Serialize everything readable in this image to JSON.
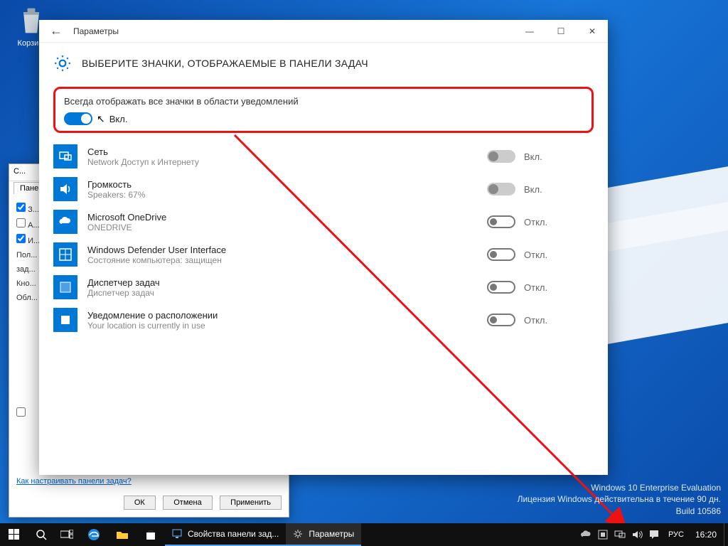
{
  "desktop": {
    "recycle_bin": "Корзи..."
  },
  "propsheet": {
    "title": "С...",
    "tab": "Пане...",
    "chk1": "З...",
    "chk2": "А...",
    "chk3": "И...",
    "lbl_pol": "Пол...",
    "lbl_zad": "зад...",
    "lbl_kno": "Кно...",
    "lbl_obl": "Обл...",
    "link": "Как настраивать панели задач?",
    "btn_ok": "ОК",
    "btn_cancel": "Отмена",
    "btn_apply": "Применить"
  },
  "settings": {
    "window_title": "Параметры",
    "heading": "ВЫБЕРИТЕ ЗНАЧКИ, ОТОБРАЖАЕМЫЕ В ПАНЕЛИ ЗАДАЧ",
    "master_label": "Всегда отображать все значки в области уведомлений",
    "master_state": "Вкл.",
    "items": [
      {
        "title": "Сеть",
        "sub": "Network Доступ к Интернету",
        "state": "Вкл.",
        "style": "off-disabled"
      },
      {
        "title": "Громкость",
        "sub": "Speakers: 67%",
        "state": "Вкл.",
        "style": "off-disabled"
      },
      {
        "title": "Microsoft OneDrive",
        "sub": "ONEDRIVE",
        "state": "Откл.",
        "style": "off-outlined"
      },
      {
        "title": "Windows Defender User Interface",
        "sub": "Состояние компьютера: защищен",
        "state": "Откл.",
        "style": "off-outlined"
      },
      {
        "title": "Диспетчер задач",
        "sub": "Диспетчер задач",
        "state": "Откл.",
        "style": "off-outlined"
      },
      {
        "title": "Уведомление о расположении",
        "sub": "Your location is currently in use",
        "state": "Откл.",
        "style": "off-outlined"
      }
    ]
  },
  "watermark": {
    "line1": "Windows 10 Enterprise Evaluation",
    "line2": "Лицензия Windows действительна в течение 90 дн.",
    "line3": "Build 10586"
  },
  "taskbar": {
    "task1": "Свойства панели зад...",
    "task2": "Параметры",
    "lang": "РУС",
    "clock": "16:20"
  }
}
